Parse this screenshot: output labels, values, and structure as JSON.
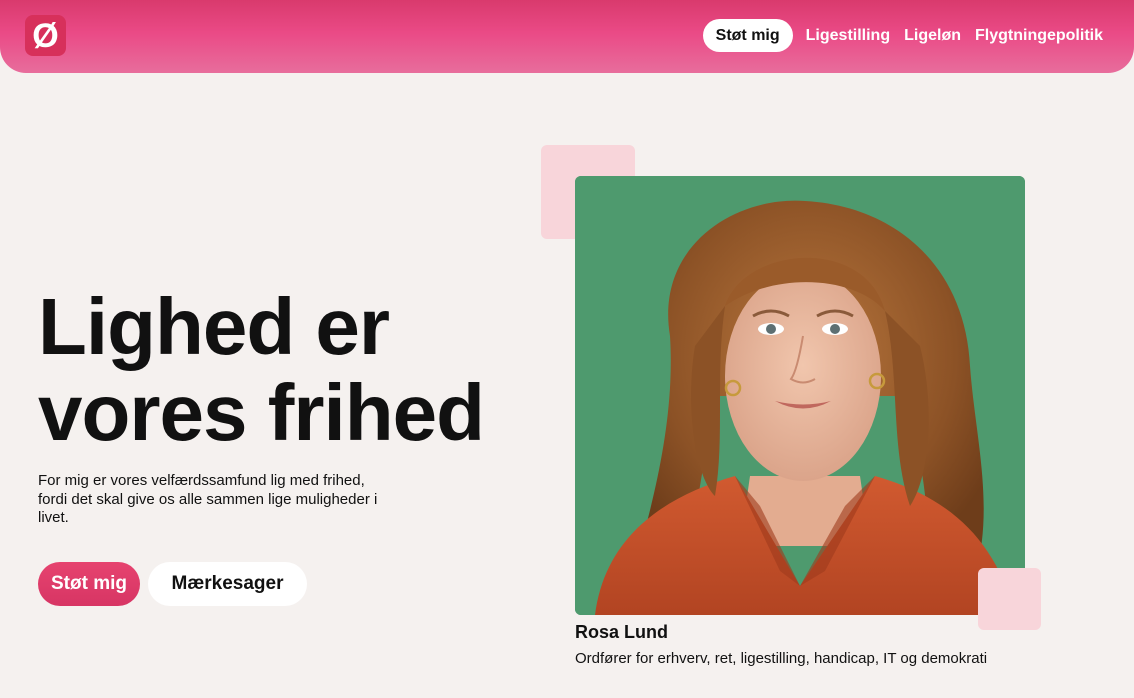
{
  "logo": {
    "glyph": "Ø"
  },
  "nav": {
    "support_label": "Støt mig",
    "links": [
      "Ligestilling",
      "Ligeløn",
      "Flygtningepolitik"
    ]
  },
  "hero": {
    "headline_line1": "Lighed er",
    "headline_line2": "vores frihed",
    "intro": "For mig er vores velfærdssamfund lig med frihed, fordi det skal give os alle sammen lige muligheder i livet.",
    "primary_button": "Støt mig",
    "secondary_button": "Mærkesager"
  },
  "profile": {
    "name": "Rosa Lund",
    "role": "Ordfører for erhverv, ret, ligestilling, handicap, IT og demokrati"
  },
  "colors": {
    "brand_pink": "#e6436f",
    "photo_background": "#4e9a6e",
    "accent_square": "#f8d5da",
    "page_background": "#f5f1ef"
  }
}
